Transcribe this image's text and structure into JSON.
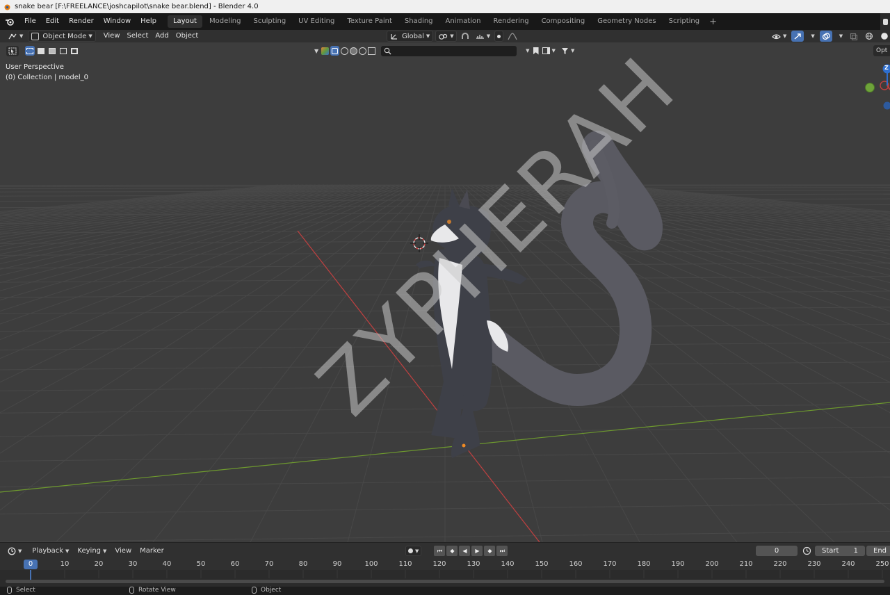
{
  "window": {
    "title": "snake bear [F:\\FREELANCE\\joshcapilot\\snake bear.blend] - Blender 4.0"
  },
  "topbar": {
    "menus": [
      "File",
      "Edit",
      "Render",
      "Window",
      "Help"
    ],
    "workspaces": [
      "Layout",
      "Modeling",
      "Sculpting",
      "UV Editing",
      "Texture Paint",
      "Shading",
      "Animation",
      "Rendering",
      "Compositing",
      "Geometry Nodes",
      "Scripting"
    ],
    "active_workspace": "Layout",
    "add_workspace": "+"
  },
  "viewport_header": {
    "mode": "Object Mode",
    "menus": [
      "View",
      "Select",
      "Add",
      "Object"
    ],
    "transform_orientation": "Global",
    "options_label": "Opt"
  },
  "viewport": {
    "perspective_label": "User Perspective",
    "collection_label": "(0) Collection | model_0",
    "watermark": "ZYPHERAH"
  },
  "gizmo": {
    "z_label": "Z"
  },
  "timeline": {
    "menus": [
      "Playback",
      "Keying",
      "View",
      "Marker"
    ],
    "current_frame": "0",
    "start_label": "Start",
    "start_value": "1",
    "end_label": "End",
    "ticks": [
      "0",
      "10",
      "20",
      "30",
      "40",
      "50",
      "60",
      "70",
      "80",
      "90",
      "100",
      "110",
      "120",
      "130",
      "140",
      "150",
      "160",
      "170",
      "180",
      "190",
      "200",
      "210",
      "220",
      "230",
      "240",
      "250"
    ]
  },
  "statusbar": {
    "select": "Select",
    "rotate": "Rotate View",
    "object": "Object"
  },
  "colors": {
    "accent": "#4772b3",
    "viewport_bg": "#3d3d3d",
    "x_axis": "#c04040",
    "y_axis": "#6e9a2e"
  }
}
